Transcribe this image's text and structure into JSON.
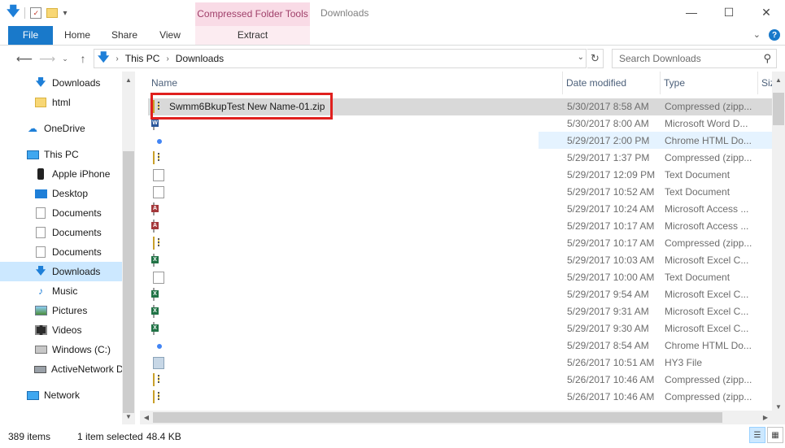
{
  "window": {
    "title": "Downloads",
    "context_tab_group": "Compressed Folder Tools",
    "controls": {
      "minimize": "—",
      "maximize": "☐",
      "close": "✕"
    }
  },
  "ribbon": {
    "tabs": [
      "File",
      "Home",
      "Share",
      "View",
      "Extract"
    ]
  },
  "address": {
    "crumbs": [
      "This PC",
      "Downloads"
    ],
    "search_placeholder": "Search Downloads"
  },
  "nav_pane": {
    "items": [
      {
        "label": "Downloads",
        "icon": "downloads-icon"
      },
      {
        "label": "html",
        "icon": "folder-icon"
      },
      {
        "label": "OneDrive",
        "icon": "onedrive-icon"
      },
      {
        "label": "This PC",
        "icon": "this-pc-icon"
      },
      {
        "label": "Apple iPhone",
        "icon": "iphone-icon"
      },
      {
        "label": "Desktop",
        "icon": "desktop-icon"
      },
      {
        "label": "Documents",
        "icon": "documents-icon"
      },
      {
        "label": "Documents",
        "icon": "documents-icon"
      },
      {
        "label": "Documents",
        "icon": "documents-icon"
      },
      {
        "label": "Downloads",
        "icon": "downloads-icon",
        "selected": true
      },
      {
        "label": "Music",
        "icon": "music-icon"
      },
      {
        "label": "Pictures",
        "icon": "pictures-icon"
      },
      {
        "label": "Videos",
        "icon": "videos-icon"
      },
      {
        "label": "Windows (C:)",
        "icon": "drive-icon"
      },
      {
        "label": "ActiveNetwork D",
        "icon": "network-drive-icon"
      },
      {
        "label": "Network",
        "icon": "network-icon"
      }
    ]
  },
  "file_list": {
    "columns": [
      "Name",
      "Date modified",
      "Type",
      "Siz"
    ],
    "rows": [
      {
        "name": "Swmm6BkupTest New Name-01.zip",
        "date": "5/30/2017 8:58 AM",
        "type": "Compressed (zipp...",
        "icon": "zip-icon",
        "selected": true
      },
      {
        "name": "",
        "date": "5/30/2017 8:00 AM",
        "type": "Microsoft Word D...",
        "icon": "word-doc-icon"
      },
      {
        "name": "",
        "date": "5/29/2017 2:00 PM",
        "type": "Chrome HTML Do...",
        "icon": "chrome-icon"
      },
      {
        "name": "",
        "date": "5/29/2017 1:37 PM",
        "type": "Compressed (zipp...",
        "icon": "zip-icon"
      },
      {
        "name": "",
        "date": "5/29/2017 12:09 PM",
        "type": "Text Document",
        "icon": "text-doc-icon"
      },
      {
        "name": "",
        "date": "5/29/2017 10:52 AM",
        "type": "Text Document",
        "icon": "text-doc-icon"
      },
      {
        "name": "",
        "date": "5/29/2017 10:24 AM",
        "type": "Microsoft Access ...",
        "icon": "access-icon"
      },
      {
        "name": "",
        "date": "5/29/2017 10:17 AM",
        "type": "Microsoft Access ...",
        "icon": "access-icon"
      },
      {
        "name": "",
        "date": "5/29/2017 10:17 AM",
        "type": "Compressed (zipp...",
        "icon": "zip-icon"
      },
      {
        "name": "",
        "date": "5/29/2017 10:03 AM",
        "type": "Microsoft Excel C...",
        "icon": "excel-icon"
      },
      {
        "name": "",
        "date": "5/29/2017 10:00 AM",
        "type": "Text Document",
        "icon": "text-doc-icon"
      },
      {
        "name": "",
        "date": "5/29/2017 9:54 AM",
        "type": "Microsoft Excel C...",
        "icon": "excel-icon"
      },
      {
        "name": "",
        "date": "5/29/2017 9:31 AM",
        "type": "Microsoft Excel C...",
        "icon": "excel-icon"
      },
      {
        "name": "",
        "date": "5/29/2017 9:30 AM",
        "type": "Microsoft Excel C...",
        "icon": "excel-icon"
      },
      {
        "name": "",
        "date": "5/29/2017 8:54 AM",
        "type": "Chrome HTML Do...",
        "icon": "chrome-icon"
      },
      {
        "name": "",
        "date": "5/26/2017 10:51 AM",
        "type": "HY3 File",
        "icon": "hy3-file-icon"
      },
      {
        "name": "",
        "date": "5/26/2017 10:46 AM",
        "type": "Compressed (zipp...",
        "icon": "zip-icon"
      },
      {
        "name": "",
        "date": "5/26/2017 10:46 AM",
        "type": "Compressed (zipp...",
        "icon": "zip-icon"
      }
    ]
  },
  "status": {
    "item_count": "389 items",
    "selection": "1 item selected",
    "size": "48.4 KB"
  },
  "colors": {
    "accent": "#1979ca",
    "context_tab": "#f9dbe6",
    "selection": "#d9d9d9",
    "nav_selection": "#cce8ff",
    "highlight_box": "#e0201e"
  }
}
